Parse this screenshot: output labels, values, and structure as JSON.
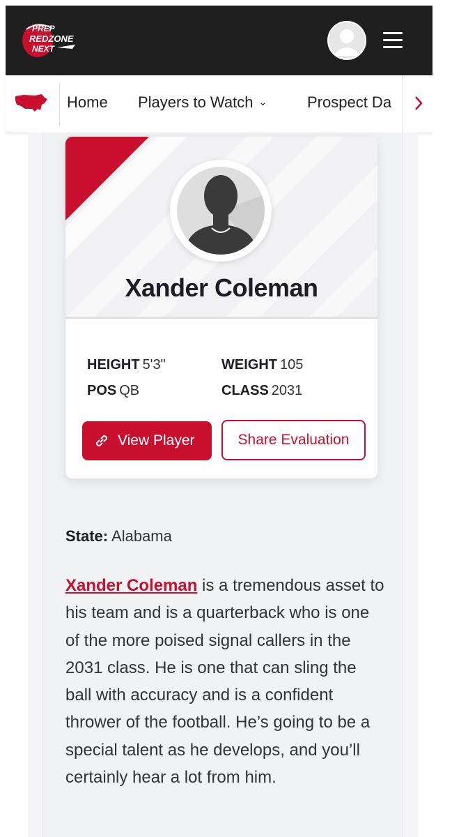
{
  "header": {
    "logo": {
      "text_lines": [
        "PREP",
        "REDZONE",
        "NEXT"
      ],
      "icon": "prep-redzone-next-logo"
    },
    "user_avatar_icon": "user-avatar-icon",
    "menu_icon": "hamburger-menu-icon"
  },
  "nav": {
    "map_icon": "usa-map-icon",
    "items": [
      {
        "label": "Home",
        "has_dropdown": false
      },
      {
        "label": "Players to Watch",
        "has_dropdown": true
      },
      {
        "label": "Prospect Da",
        "has_dropdown": false
      }
    ],
    "scroll_icon": "chevron-right-icon"
  },
  "player": {
    "name": "Xander Coleman",
    "stats": {
      "height_label": "HEIGHT",
      "height_value": "5'3\"",
      "weight_label": "WEIGHT",
      "weight_value": "105",
      "pos_label": "POS",
      "pos_value": "QB",
      "class_label": "CLASS",
      "class_value": "2031"
    },
    "view_button": "View Player",
    "share_button": "Share Evaluation"
  },
  "article": {
    "state_label": "State:",
    "state_value": "Alabama",
    "link_name": "Xander Coleman",
    "body": " is a tremendous asset to his team and is a quarterback who is one of the more poised signal callers in the 2031 class. He is one that can sling the ball with accuracy and is a confident thrower of the football. He’s going to be a special talent as he develops, and you’ll certainly hear a lot from him."
  },
  "colors": {
    "brand_red": "#c8102e",
    "header_bg": "#1f1f1f",
    "text_dark": "#1d1d27"
  }
}
